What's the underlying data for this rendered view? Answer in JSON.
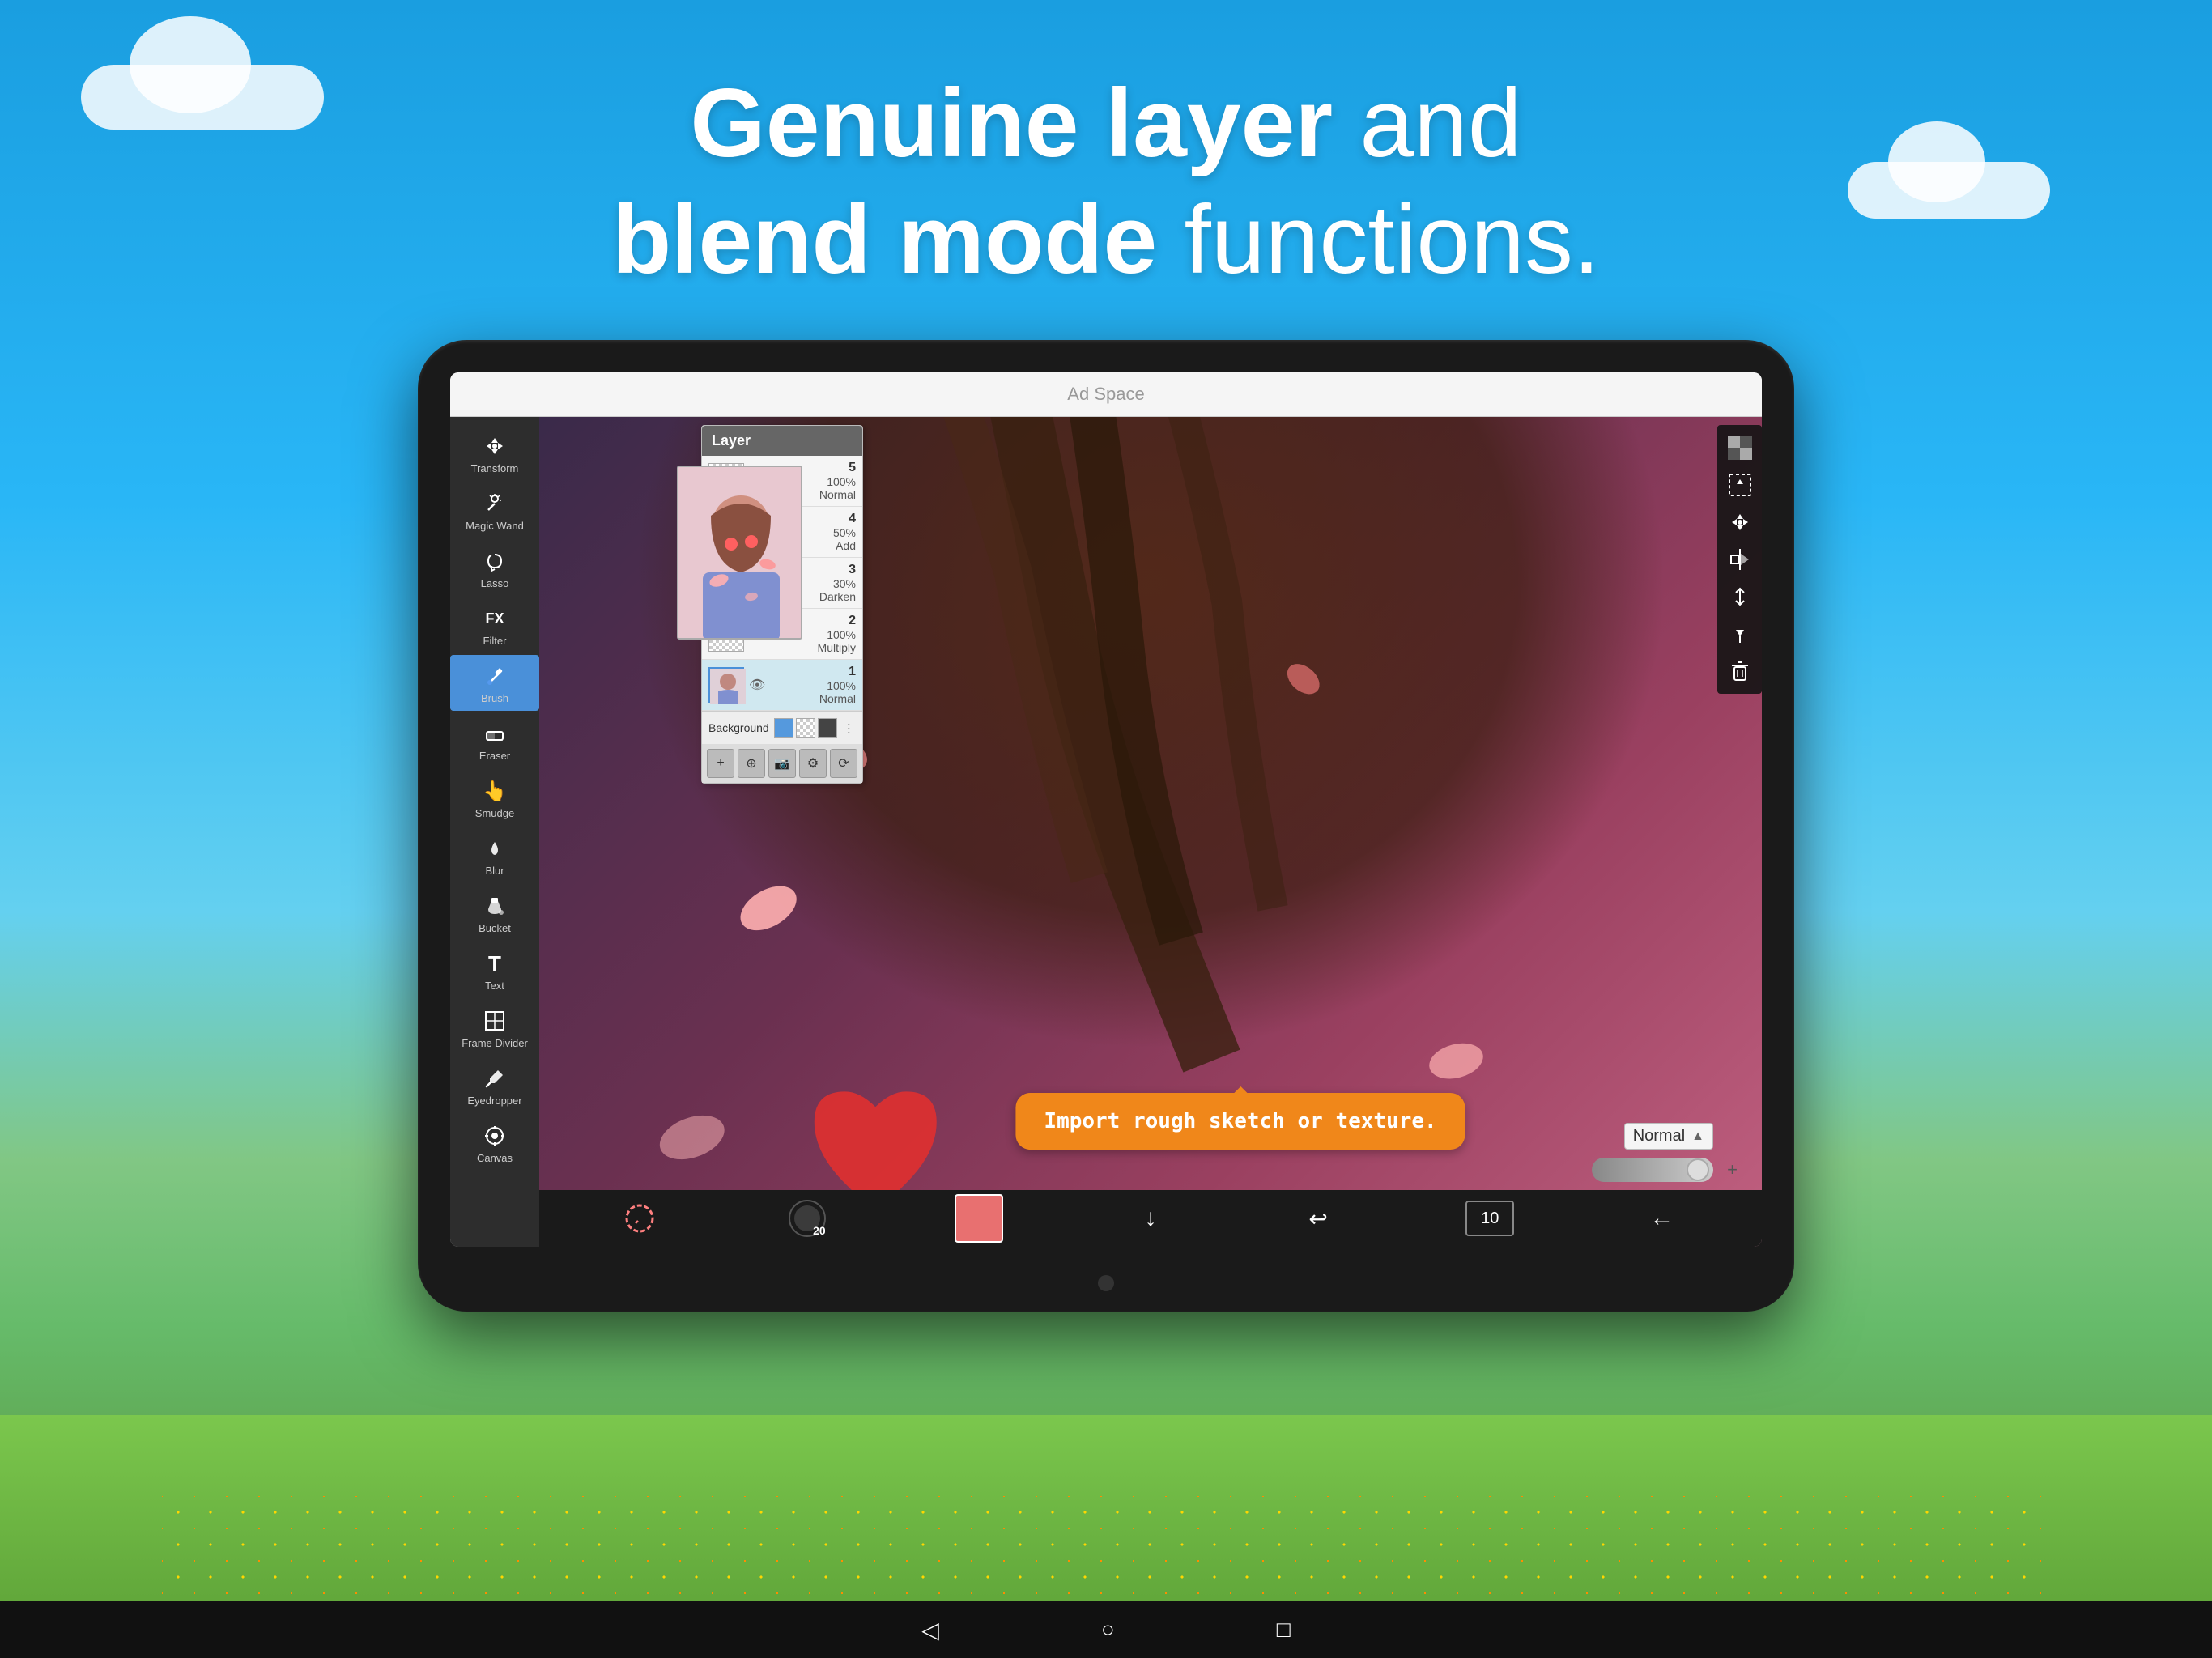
{
  "page": {
    "title": "Genuine layer and blend mode functions.",
    "title_bold1": "Genuine layer",
    "title_normal1": " and",
    "title_bold2": "blend mode",
    "title_normal2": " functions."
  },
  "ad_bar": {
    "text": "Ad Space"
  },
  "tools": {
    "items": [
      {
        "id": "transform",
        "label": "Transform",
        "icon": "⊕"
      },
      {
        "id": "magic-wand",
        "label": "Magic Wand",
        "icon": "✦"
      },
      {
        "id": "lasso",
        "label": "Lasso",
        "icon": "⌘"
      },
      {
        "id": "filter",
        "label": "Filter",
        "icon": "FX"
      },
      {
        "id": "brush",
        "label": "Brush",
        "icon": "✏"
      },
      {
        "id": "eraser",
        "label": "Eraser",
        "icon": "◻"
      },
      {
        "id": "smudge",
        "label": "Smudge",
        "icon": "👆"
      },
      {
        "id": "blur",
        "label": "Blur",
        "icon": "💧"
      },
      {
        "id": "bucket",
        "label": "Bucket",
        "icon": "🪣"
      },
      {
        "id": "text",
        "label": "Text",
        "icon": "T"
      },
      {
        "id": "frame-divider",
        "label": "Frame Divider",
        "icon": "▦"
      },
      {
        "id": "eyedropper",
        "label": "Eyedropper",
        "icon": "🔬"
      },
      {
        "id": "canvas",
        "label": "Canvas",
        "icon": "⚙"
      }
    ]
  },
  "layer_panel": {
    "title": "Layer",
    "layers": [
      {
        "num": "5",
        "opacity": "100%",
        "blend": "Normal",
        "has_content": false
      },
      {
        "num": "4",
        "opacity": "50%",
        "blend": "Add",
        "has_content": false
      },
      {
        "num": "3",
        "opacity": "30%",
        "blend": "Darken",
        "has_content": true
      },
      {
        "num": "2",
        "opacity": "100%",
        "blend": "Multiply",
        "has_content": false
      },
      {
        "num": "1",
        "opacity": "100%",
        "blend": "Normal",
        "has_content": true
      }
    ],
    "background_label": "Background",
    "blend_mode_top": "Normal",
    "action_buttons": [
      "+",
      "⊕",
      "📷",
      "⚙",
      "⟳"
    ]
  },
  "normal_dropdown": {
    "label": "Normal"
  },
  "tooltip": {
    "text": "Import rough sketch or texture."
  },
  "bottom_toolbar": {
    "buttons": [
      "↺",
      "20",
      "🎨",
      "↓",
      "↩",
      "10",
      "←"
    ]
  },
  "android_nav": {
    "back": "◁",
    "home": "○",
    "recent": "□"
  }
}
